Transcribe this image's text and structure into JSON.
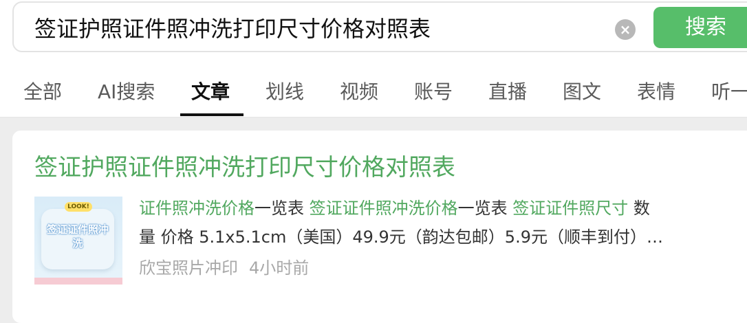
{
  "search": {
    "query": "签证护照证件照冲洗打印尺寸价格对照表",
    "clear_glyph": "×",
    "button_label": "搜索"
  },
  "tabs": [
    {
      "label": "全部"
    },
    {
      "label": "AI搜索"
    },
    {
      "label": "文章"
    },
    {
      "label": "划线"
    },
    {
      "label": "视频"
    },
    {
      "label": "账号"
    },
    {
      "label": "直播"
    },
    {
      "label": "图文"
    },
    {
      "label": "表情"
    },
    {
      "label": "听一"
    }
  ],
  "active_tab": "文章",
  "result": {
    "title": "签证护照证件照冲洗打印尺寸价格对照表",
    "thumbnail": {
      "tag": "LOOK!",
      "text": "签证证件照冲洗"
    },
    "snippet": {
      "line1": [
        {
          "text": "证件照冲洗价格",
          "hl": true
        },
        {
          "text": "一览表 ",
          "hl": false
        },
        {
          "text": "签证证件照冲洗价格",
          "hl": true
        },
        {
          "text": "一览表 ",
          "hl": false
        },
        {
          "text": "签证证件照尺寸",
          "hl": true
        },
        {
          "text": " 数",
          "hl": false
        }
      ],
      "line2": "量 价格 5.1x5.1cm（美国）49.9元（韵达包邮）5.9元（顺丰到付）…"
    },
    "source": "欣宝照片冲印",
    "time": "4小时前"
  },
  "colors": {
    "accent_green": "#57be6a",
    "link_green": "#51a85f"
  }
}
